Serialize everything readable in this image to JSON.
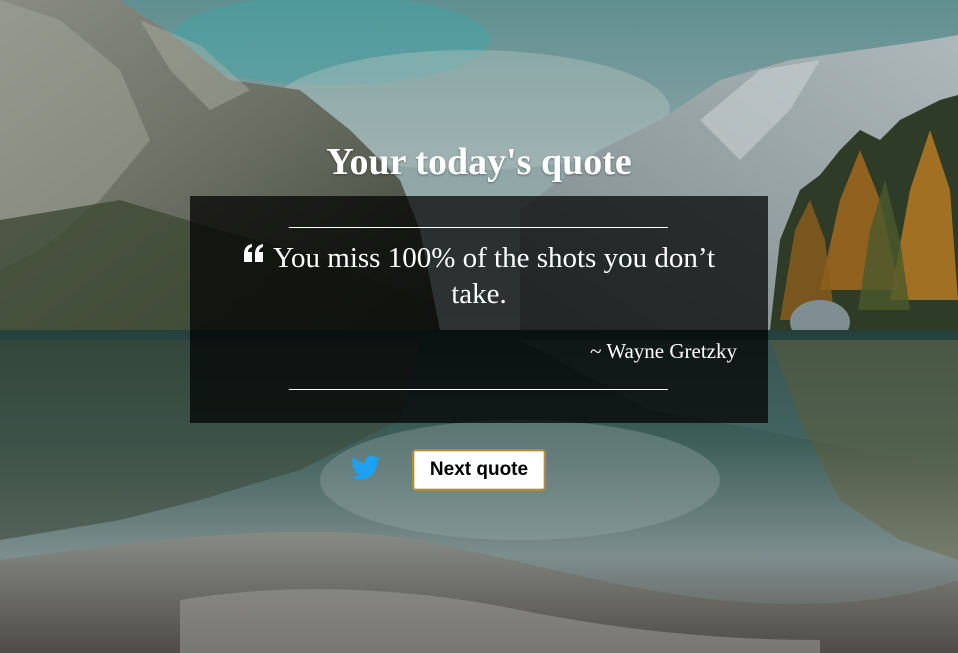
{
  "page": {
    "title": "Your today's quote"
  },
  "quote": {
    "icon": "quote-left-icon",
    "text": "You miss 100% of the shots you don’t take.",
    "author": "~ Wayne Gretzky"
  },
  "actions": {
    "tweet_icon": "twitter-icon",
    "next_label": "Next quote"
  },
  "colors": {
    "card_background": "rgba(0,0,0,0.72)",
    "text": "#ffffff",
    "twitter_blue": "#1da1f2",
    "button_border": "#b08a3e"
  }
}
